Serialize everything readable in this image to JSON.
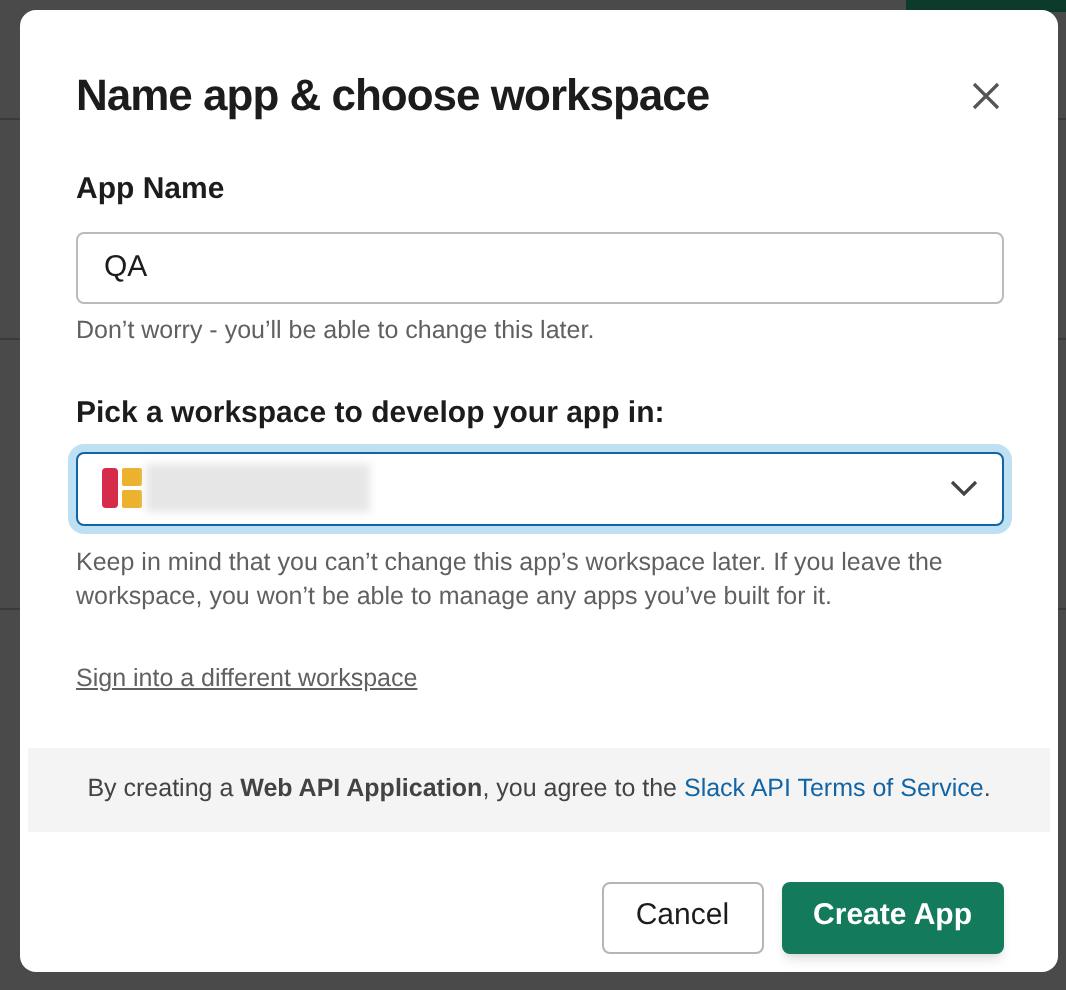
{
  "dialog": {
    "title": "Name app & choose workspace",
    "app_name": {
      "label": "App Name",
      "value": "QA",
      "hint": "Don’t worry - you’ll be able to change this later."
    },
    "workspace": {
      "label": "Pick a workspace to develop your app in:",
      "focused": true,
      "hint": "Keep in mind that you can’t change this app’s workspace later. If you leave the workspace, you won’t be able to manage any apps you’ve built for it."
    },
    "sign_in_link": "Sign into a different workspace",
    "terms": {
      "text": "By creating a **Web API Application**, you agree to the",
      "link": "Slack API Terms of Service",
      "end": "."
    },
    "buttons": [
      {
        "label": "Cancel",
        "kind": "secondary"
      },
      {
        "label": "Create App",
        "kind": "primary"
      }
    ]
  }
}
